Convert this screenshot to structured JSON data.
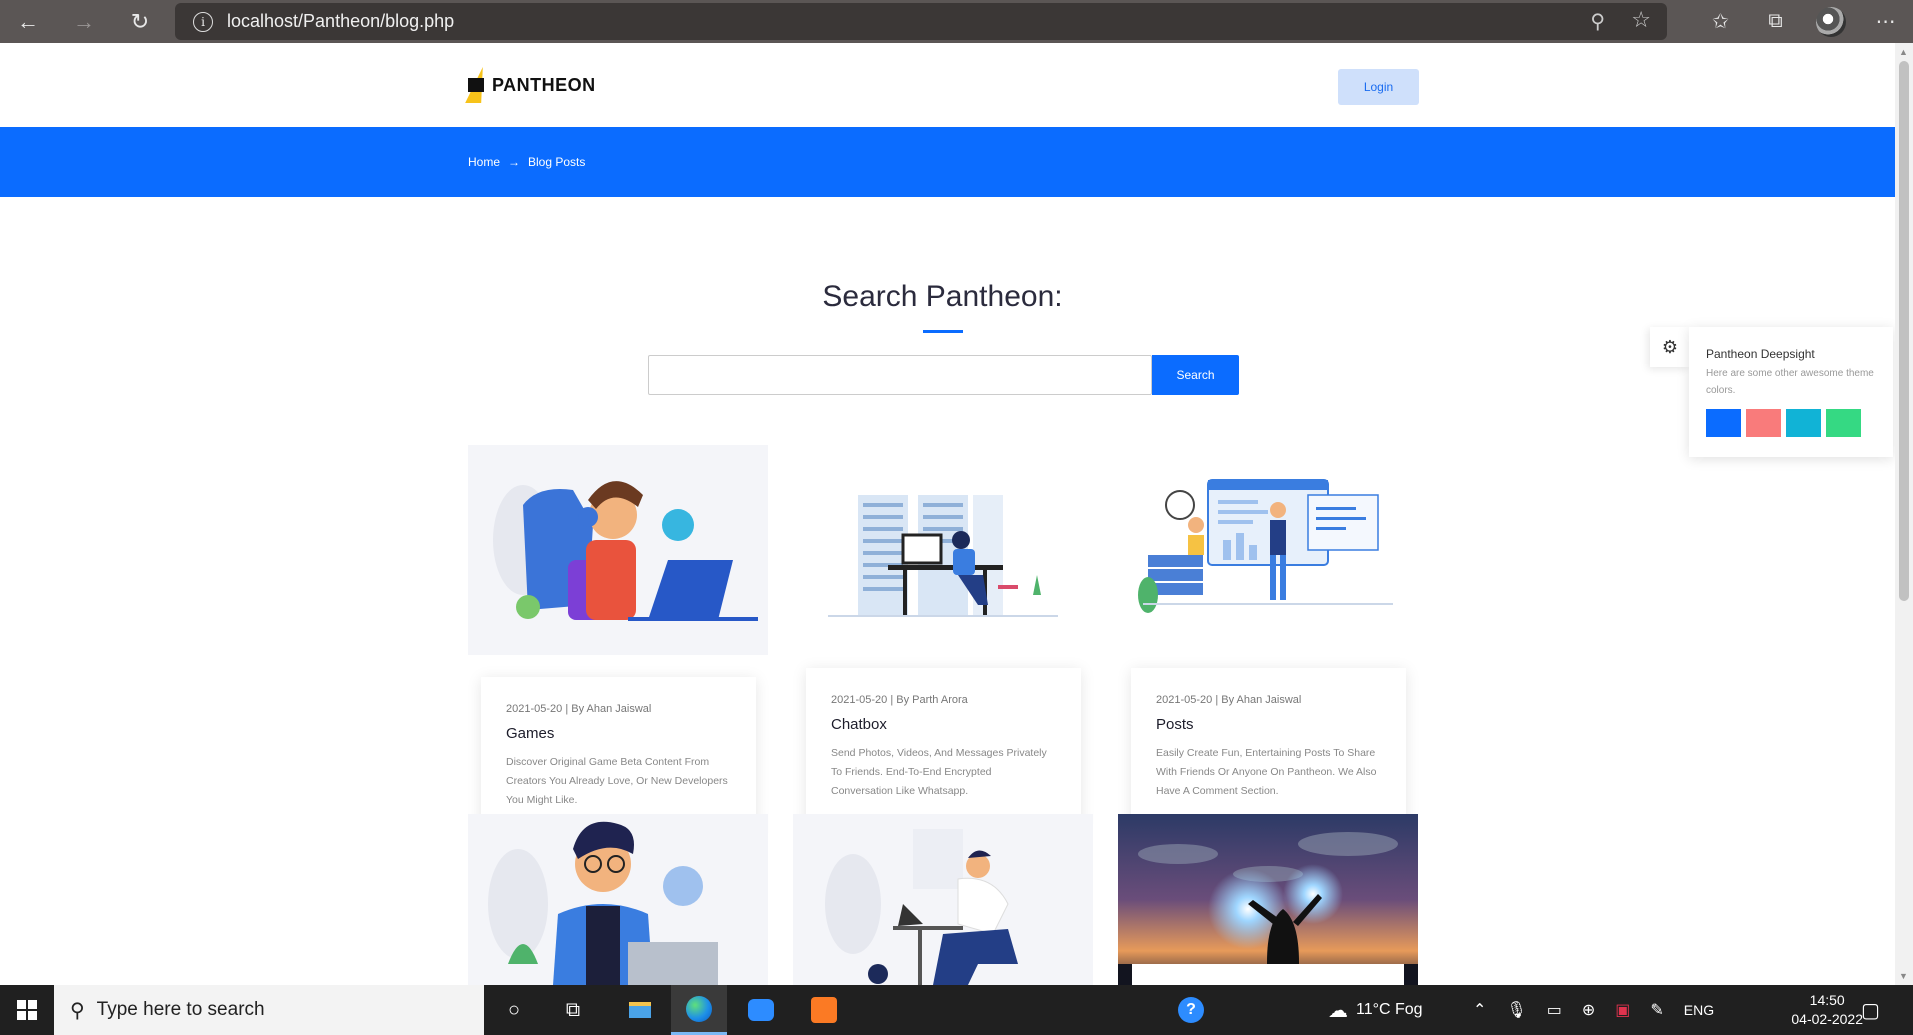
{
  "browser": {
    "url": "localhost/Pantheon/blog.php",
    "back_icon": "arrow-left-icon",
    "forward_icon": "arrow-right-icon",
    "refresh_icon": "refresh-icon"
  },
  "header": {
    "logo_text": "PANTHEON",
    "login_label": "Login"
  },
  "breadcrumb": {
    "home": "Home",
    "separator": "→",
    "current": "Blog Posts"
  },
  "search": {
    "title": "Search Pantheon:",
    "placeholder": "",
    "button_label": "Search"
  },
  "posts": [
    {
      "meta": "2021-05-20 | By Ahan Jaiswal",
      "title": "Games",
      "desc": "Discover Original Game Beta Content From Creators You Already Love, Or New Developers You Might Like."
    },
    {
      "meta": "2021-05-20 | By Parth Arora",
      "title": "Chatbox",
      "desc": "Send Photos, Videos, And Messages Privately To Friends. End-To-End Encrypted Conversation Like Whatsapp."
    },
    {
      "meta": "2021-05-20 | By Ahan Jaiswal",
      "title": "Posts",
      "desc": "Easily Create Fun, Entertaining Posts To Share With Friends Or Anyone On Pantheon. We Also Have A Comment Section."
    }
  ],
  "theme_panel": {
    "title": "Pantheon Deepsight",
    "subtitle": "Here are some other awesome theme colors.",
    "colors": [
      "#0b6cff",
      "#f97b7b",
      "#11b3d6",
      "#35d983"
    ]
  },
  "taskbar": {
    "search_placeholder": "Type here to search",
    "weather": "11°C  Fog",
    "language": "ENG",
    "time": "14:50",
    "date": "04-02-2022"
  },
  "colors": {
    "primary": "#0b6cff",
    "chrome": "#5b5655",
    "taskbar": "#202020"
  }
}
